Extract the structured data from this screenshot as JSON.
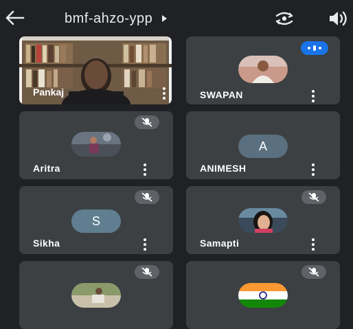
{
  "meeting": {
    "code": "bmf-ahzo-ypp"
  },
  "colors": {
    "background": "#202124",
    "tile": "#3c4043",
    "speaking": "#1a73e8",
    "mute_badge": "#5f6368"
  },
  "participants": [
    {
      "name": "Pankaj",
      "state": "video"
    },
    {
      "name": "SWAPAN",
      "state": "speaking"
    },
    {
      "name": "Aritra",
      "state": "muted"
    },
    {
      "name": "ANIMESH",
      "avatar_letter": "A"
    },
    {
      "name": "Sikha",
      "state": "muted",
      "avatar_letter": "S"
    },
    {
      "name": "Samapti",
      "state": "muted"
    },
    {
      "name": "",
      "state": "muted"
    },
    {
      "name": "",
      "state": "muted"
    }
  ],
  "icons": {
    "back": "arrow-left-icon",
    "dropdown": "caret-right-icon",
    "camera_switch": "switch-camera-icon",
    "audio": "speaker-icon",
    "more": "more-vert-icon",
    "muted": "mic-off-icon",
    "speaking": "audio-level-icon"
  }
}
